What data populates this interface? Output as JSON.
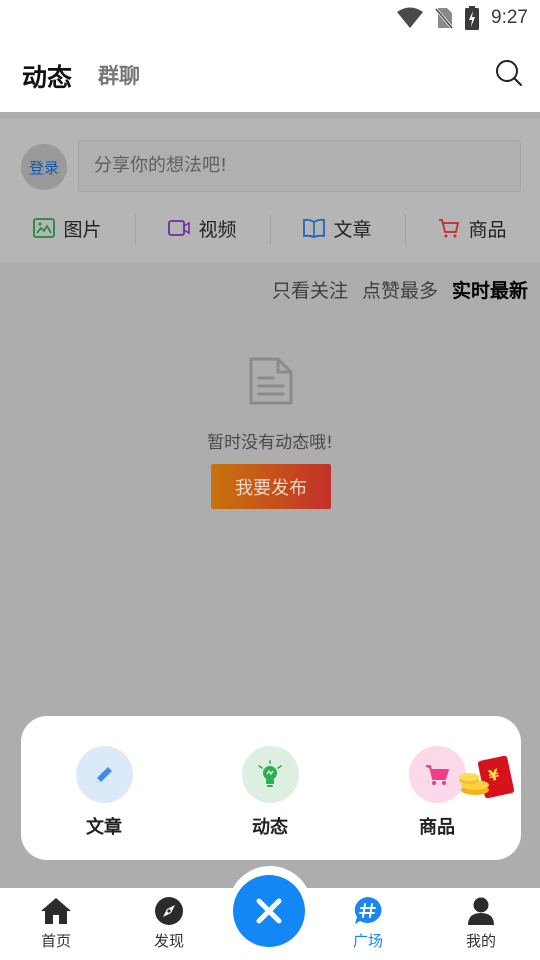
{
  "status_bar": {
    "time": "9:27"
  },
  "header": {
    "tab_active": "动态",
    "tab_inactive": "群聊",
    "search_icon": "search-icon"
  },
  "compose": {
    "login_label": "登录",
    "placeholder": "分享你的想法吧!",
    "types": [
      {
        "label": "图片",
        "icon": "image-icon",
        "color": "#1e8a3c"
      },
      {
        "label": "视频",
        "icon": "video-icon",
        "color": "#6b2fa3"
      },
      {
        "label": "文章",
        "icon": "book-icon",
        "color": "#1f66b8"
      },
      {
        "label": "商品",
        "icon": "cart-icon",
        "color": "#c42a2a"
      }
    ]
  },
  "filters": [
    {
      "label": "只看关注",
      "active": false
    },
    {
      "label": "点赞最多",
      "active": false
    },
    {
      "label": "实时最新",
      "active": true
    }
  ],
  "empty_state": {
    "text": "暂时没有动态哦!",
    "button": "我要发布"
  },
  "popup": {
    "items": [
      {
        "label": "文章",
        "icon": "pencil-icon",
        "bg": "#dbe9f9",
        "color": "#3a8ee8"
      },
      {
        "label": "动态",
        "icon": "lightbulb-icon",
        "bg": "#dcefe0",
        "color": "#2fae52"
      },
      {
        "label": "商品",
        "icon": "cart-icon",
        "bg": "#fbd9e8",
        "color": "#ee3f8a"
      }
    ],
    "red_packet_symbol": "¥"
  },
  "bottom_nav": {
    "items": [
      {
        "label": "首页",
        "icon": "home-icon",
        "active": false
      },
      {
        "label": "发现",
        "icon": "compass-icon",
        "active": false
      },
      {
        "label": "广场",
        "icon": "hashtag-chat-icon",
        "active": true
      },
      {
        "label": "我的",
        "icon": "person-icon",
        "active": false
      }
    ],
    "center_icon": "close-icon",
    "accent": "#1287f5"
  }
}
